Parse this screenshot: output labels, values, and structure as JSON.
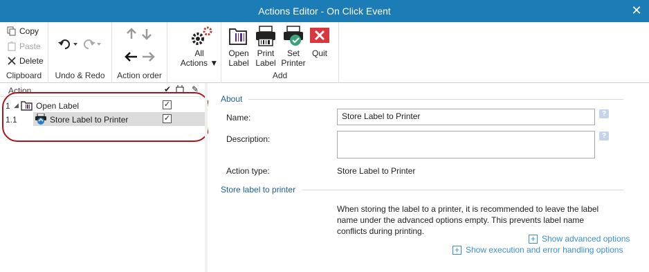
{
  "window": {
    "title": "Actions Editor - On Click Event",
    "close_glyph": "✕"
  },
  "ribbon": {
    "clipboard": {
      "label": "Clipboard",
      "copy": "Copy",
      "paste": "Paste",
      "delete": "Delete"
    },
    "undo_redo": {
      "label": "Undo & Redo"
    },
    "action_order": {
      "label": "Action order"
    },
    "all_actions": {
      "line1": "All",
      "line2": "Actions"
    },
    "add": {
      "label": "Add",
      "open_label": [
        "Open",
        "Label"
      ],
      "print_label": [
        "Print",
        "Label"
      ],
      "set_printer": [
        "Set",
        "Printer"
      ],
      "quit": "Quit"
    }
  },
  "tree": {
    "column_header": "Action",
    "rows": [
      {
        "number": "1",
        "label": "Open Label",
        "checked": true
      },
      {
        "number": "1.1",
        "label": "Store Label to Printer",
        "checked": true
      }
    ]
  },
  "details": {
    "about_section": "About",
    "name_label": "Name:",
    "name_value": "Store Label to Printer",
    "description_label": "Description:",
    "description_value": "",
    "action_type_label": "Action type:",
    "action_type_value": "Store Label to Printer",
    "store_section": "Store label to printer",
    "info_text": "When storing the label to a printer, it is recommended to leave the label name under the advanced options empty. This prevents label name conflicts during printing.",
    "show_advanced": "Show advanced options",
    "show_execution": "Show execution and error handling options"
  },
  "colors": {
    "titlebar": "#1c7cb6",
    "highlight_circle": "#a8161c",
    "link": "#3a8fd4",
    "section": "#1c5f98"
  }
}
